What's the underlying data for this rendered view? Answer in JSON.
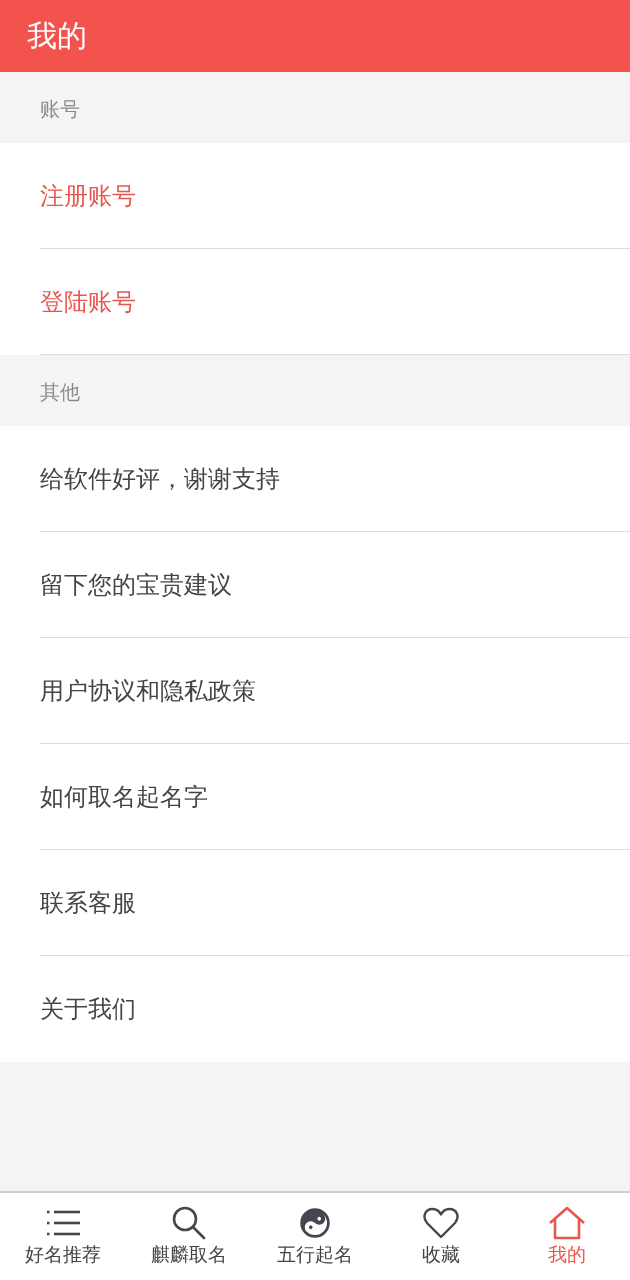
{
  "header": {
    "title": "我的"
  },
  "sections": [
    {
      "kind": "account",
      "title": "账号",
      "items": [
        "注册账号",
        "登陆账号"
      ]
    },
    {
      "kind": "other",
      "title": "其他",
      "items": [
        "给软件好评，谢谢支持",
        "留下您的宝贵建议",
        "用户协议和隐私政策",
        "如何取名起名字",
        "联系客服",
        "关于我们"
      ]
    }
  ],
  "tabs": [
    {
      "label": "好名推荐",
      "selected": false
    },
    {
      "label": "麒麟取名",
      "selected": false
    },
    {
      "label": "五行起名",
      "selected": false
    },
    {
      "label": "收藏",
      "selected": false
    },
    {
      "label": "我的",
      "selected": true
    }
  ]
}
